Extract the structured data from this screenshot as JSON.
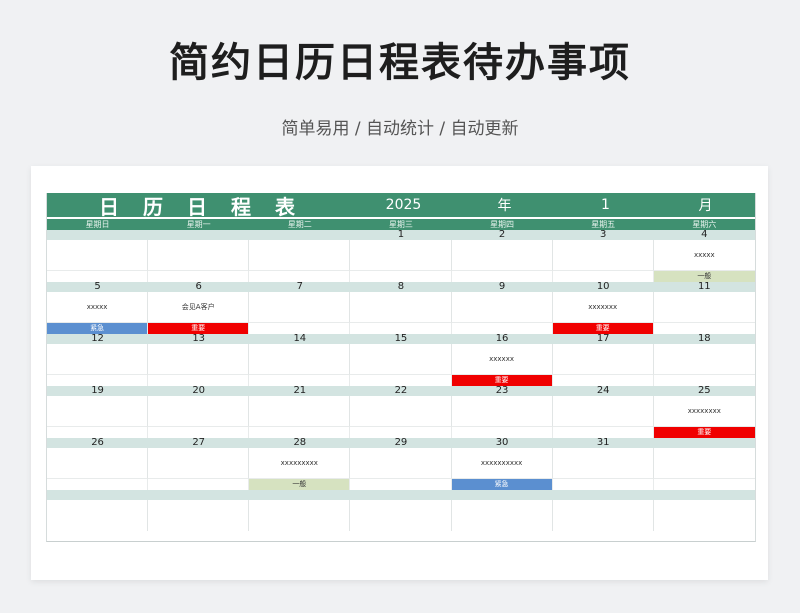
{
  "page": {
    "title": "简约日历日程表待办事项",
    "subtitle": "简单易用 / 自动统计 / 自动更新"
  },
  "header": {
    "label_chars": [
      "日",
      "历",
      "日",
      "程",
      "表"
    ],
    "year": "2025",
    "year_unit": "年",
    "month": "1",
    "month_unit": "月"
  },
  "weekdays": [
    "星期日",
    "星期一",
    "星期二",
    "星期三",
    "星期四",
    "星期五",
    "星期六"
  ],
  "weeks": [
    {
      "dates": [
        "",
        "",
        "",
        "1",
        "2",
        "3",
        "4"
      ],
      "notes": [
        "",
        "",
        "",
        "",
        "",
        "",
        "xxxxx"
      ],
      "tags": [
        "",
        "",
        "",
        "",
        "",
        "",
        "一般"
      ]
    },
    {
      "dates": [
        "5",
        "6",
        "7",
        "8",
        "9",
        "10",
        "11"
      ],
      "notes": [
        "xxxxx",
        "会见A客户",
        "",
        "",
        "",
        "xxxxxxx",
        ""
      ],
      "tags": [
        "紧急",
        "重要",
        "",
        "",
        "",
        "重要",
        ""
      ]
    },
    {
      "dates": [
        "12",
        "13",
        "14",
        "15",
        "16",
        "17",
        "18"
      ],
      "notes": [
        "",
        "",
        "",
        "",
        "xxxxxx",
        "",
        ""
      ],
      "tags": [
        "",
        "",
        "",
        "",
        "重要",
        "",
        ""
      ]
    },
    {
      "dates": [
        "19",
        "20",
        "21",
        "22",
        "23",
        "24",
        "25"
      ],
      "notes": [
        "",
        "",
        "",
        "",
        "",
        "",
        "xxxxxxxx"
      ],
      "tags": [
        "",
        "",
        "",
        "",
        "",
        "",
        "重要"
      ]
    },
    {
      "dates": [
        "26",
        "27",
        "28",
        "29",
        "30",
        "31",
        ""
      ],
      "notes": [
        "",
        "",
        "xxxxxxxxx",
        "",
        "xxxxxxxxxx",
        "",
        ""
      ],
      "tags": [
        "",
        "",
        "一般",
        "",
        "紧急",
        "",
        ""
      ]
    }
  ],
  "tag_colors": {
    "重要": "#f00000",
    "紧急": "#5b8fd0",
    "一般": "#d6e2c0"
  }
}
